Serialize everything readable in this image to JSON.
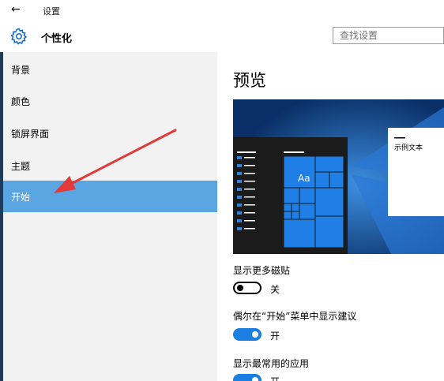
{
  "window": {
    "title": "设置",
    "back_glyph": "←"
  },
  "header": {
    "section_title": "个性化",
    "search_placeholder": "查找设置"
  },
  "sidebar": {
    "items": [
      {
        "label": "背景"
      },
      {
        "label": "颜色"
      },
      {
        "label": "锁屏界面"
      },
      {
        "label": "主题"
      },
      {
        "label": "开始",
        "selected": true
      }
    ]
  },
  "content": {
    "preview_title": "预览",
    "preview_sample_text": "示例文本",
    "preview_tile_text": "Aa",
    "options": [
      {
        "label": "显示更多磁贴",
        "state": "关",
        "on": false
      },
      {
        "label": "偶尔在“开始”菜单中显示建议",
        "state": "开",
        "on": true
      },
      {
        "label": "显示最常用的应用",
        "state": "开",
        "on": true
      }
    ]
  },
  "colors": {
    "accent": "#1a7fe0",
    "selected_item": "#5aa6e2",
    "annotation_arrow": "#e03a3a"
  }
}
